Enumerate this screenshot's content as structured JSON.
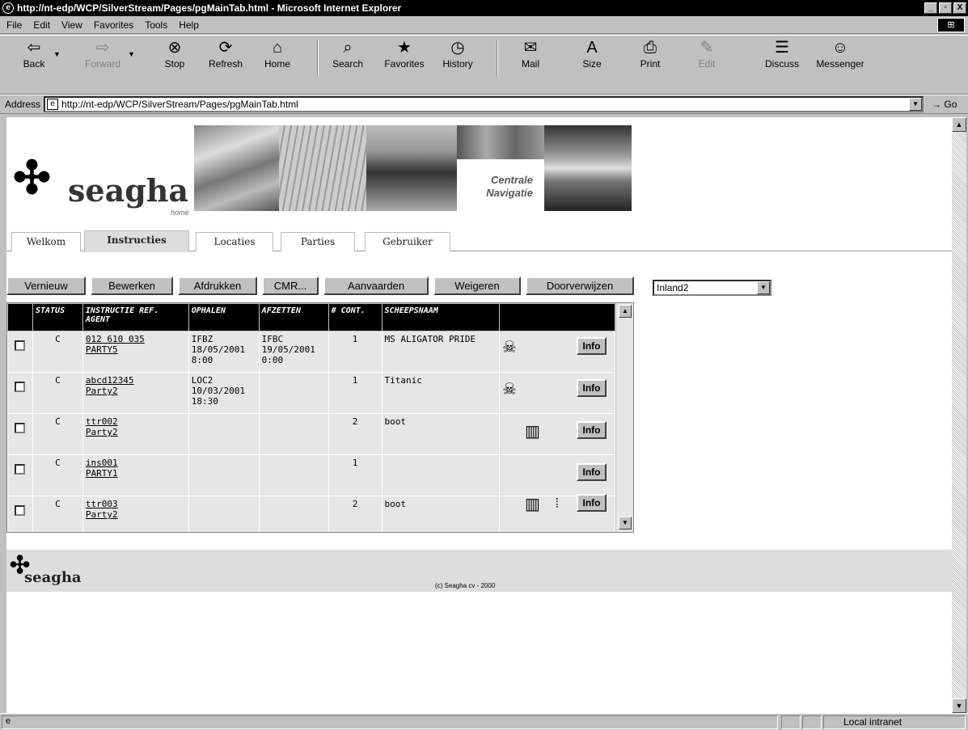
{
  "window": {
    "title": "http://nt-edp/WCP/SilverStream/Pages/pgMainTab.html - Microsoft Internet Explorer",
    "controls": [
      "_",
      "▫",
      "X"
    ]
  },
  "menu": [
    "File",
    "Edit",
    "View",
    "Favorites",
    "Tools",
    "Help"
  ],
  "toolbar": {
    "back": "Back",
    "forward": "Forward",
    "stop": "Stop",
    "refresh": "Refresh",
    "home": "Home",
    "search": "Search",
    "favorites": "Favorites",
    "history": "History",
    "mail": "Mail",
    "size": "Size",
    "print": "Print",
    "edit": "Edit",
    "discuss": "Discuss",
    "messenger": "Messenger"
  },
  "address": {
    "label": "Address",
    "url": "http://nt-edp/WCP/SilverStream/Pages/pgMainTab.html",
    "go": "Go"
  },
  "banner": {
    "logo_word": "seagha",
    "logo_sub": "home",
    "caption_line1": "Centrale",
    "caption_line2": "Navigatie"
  },
  "tabs": [
    "Welkom",
    "Instructies",
    "Locaties",
    "Parties",
    "Gebruiker"
  ],
  "active_tab": "Instructies",
  "actions": {
    "vernieuw": "Vernieuw",
    "bewerken": "Bewerken",
    "afdrukken": "Afdrukken",
    "cmr": "CMR...",
    "aanvaarden": "Aanvaarden",
    "weigeren": "Weigeren",
    "doorverwijzen": "Doorverwijzen"
  },
  "filter": {
    "selected": "Inland2"
  },
  "table": {
    "headers": {
      "status": "STATUS",
      "ref_line1": "INSTRUCTIE REF.",
      "ref_line2": "AGENT",
      "ophalen": "OPHALEN",
      "afzetten": "AFZETTEN",
      "cont": "# CONT.",
      "schip": "SCHEEPSNAAM"
    },
    "info_label": "Info",
    "rows": [
      {
        "status": "C",
        "ref": "012 610 035",
        "agent": "PARTY5",
        "ophalen": "IFBZ",
        "ophalen_date": "18/05/2001",
        "ophalen_time": "8:00",
        "afzetten": "IFBC",
        "afzetten_date": "19/05/2001",
        "afzetten_time": "0:00",
        "cont": "1",
        "schip": "MS ALIGATOR PRIDE"
      },
      {
        "status": "C",
        "ref": "abcd12345",
        "agent": "Party2",
        "ophalen": "LOC2",
        "ophalen_date": "10/03/2001",
        "ophalen_time": "18:30",
        "afzetten": "",
        "afzetten_date": "",
        "afzetten_time": "",
        "cont": "1",
        "schip": "Titanic"
      },
      {
        "status": "C",
        "ref": "ttr002",
        "agent": "Party2",
        "ophalen": "",
        "ophalen_date": "",
        "ophalen_time": "",
        "afzetten": "",
        "afzetten_date": "",
        "afzetten_time": "",
        "cont": "2",
        "schip": "boot"
      },
      {
        "status": "C",
        "ref": "ins001",
        "agent": "PARTY1",
        "ophalen": "",
        "ophalen_date": "",
        "ophalen_time": "",
        "afzetten": "",
        "afzetten_date": "",
        "afzetten_time": "",
        "cont": "1",
        "schip": ""
      },
      {
        "status": "C",
        "ref": "ttr003",
        "agent": "Party2",
        "ophalen": "",
        "ophalen_date": "",
        "ophalen_time": "",
        "afzetten": "",
        "afzetten_date": "",
        "afzetten_time": "",
        "cont": "2",
        "schip": "boot"
      }
    ]
  },
  "footer": {
    "logo_word": "seagha",
    "copyright": "(c) Seagha cv - 2000"
  },
  "status": {
    "zone": "Local intranet"
  }
}
